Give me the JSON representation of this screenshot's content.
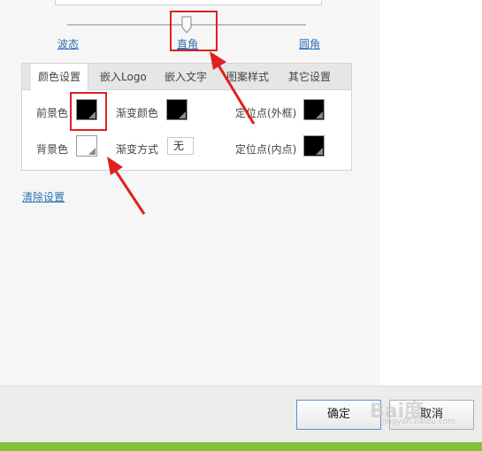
{
  "slider": {
    "labels": [
      "波态",
      "直角",
      "圆角"
    ],
    "value_label": "直角"
  },
  "tabs": [
    {
      "label": "颜色设置",
      "active": true
    },
    {
      "label": "嵌入Logo",
      "active": false
    },
    {
      "label": "嵌入文字",
      "active": false
    },
    {
      "label": "图案样式",
      "active": false
    },
    {
      "label": "其它设置",
      "active": false
    }
  ],
  "color_settings": {
    "foreground_label": "前景色",
    "background_label": "背景色",
    "gradient_color_label": "渐变颜色",
    "gradient_mode_label": "渐变方式",
    "gradient_mode_value": "无",
    "anchor_outer_label": "定位点(外框)",
    "anchor_inner_label": "定位点(内点)",
    "colors": {
      "foreground": "#000000",
      "background": "#ffffff",
      "gradient": "#000000",
      "anchor_outer": "#000000",
      "anchor_inner": "#000000"
    }
  },
  "clear_link": "清除设置",
  "footer": {
    "ok_label": "确定",
    "cancel_label": "取消"
  },
  "watermark": {
    "text": "Bai度",
    "sub": "jingyan.baidu.com"
  },
  "accent_colors": {
    "link": "#2b6fb6",
    "annotation": "#e02020",
    "status_bar": "#86bf3c"
  }
}
